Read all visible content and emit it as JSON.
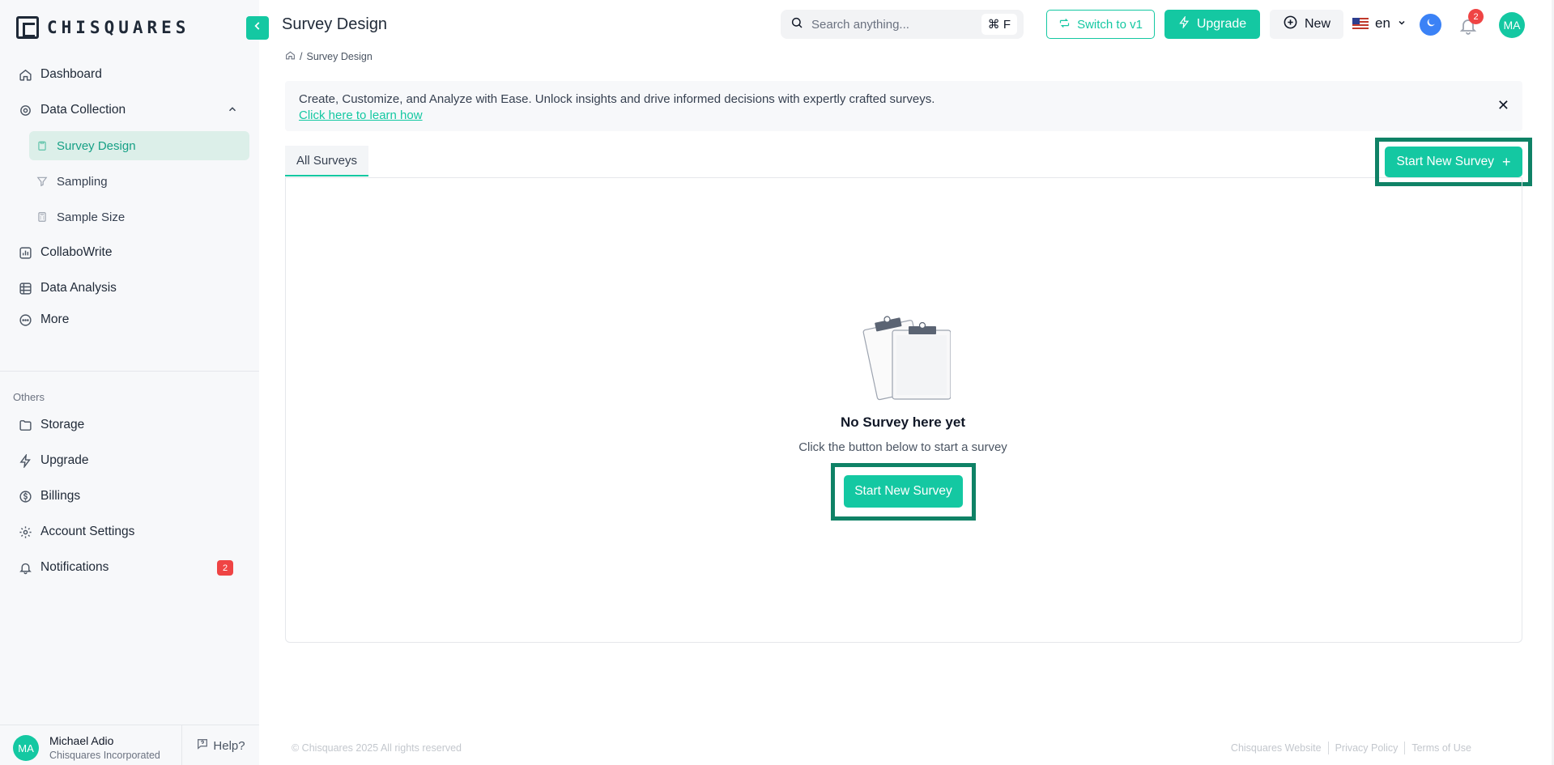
{
  "brand": {
    "name": "CHISQUARES"
  },
  "sidebar": {
    "items": [
      {
        "label": "Dashboard",
        "icon": "home-icon"
      },
      {
        "label": "Data Collection",
        "icon": "data-collection-icon"
      },
      {
        "label": "CollaboWrite",
        "icon": "collabowrite-icon"
      },
      {
        "label": "Data Analysis",
        "icon": "data-analysis-icon"
      },
      {
        "label": "More",
        "icon": "more-icon"
      }
    ],
    "sub_items": [
      {
        "label": "Survey Design",
        "active": true
      },
      {
        "label": "Sampling",
        "active": false
      },
      {
        "label": "Sample Size",
        "active": false
      }
    ],
    "others_label": "Others",
    "other_items": [
      {
        "label": "Storage"
      },
      {
        "label": "Upgrade"
      },
      {
        "label": "Billings"
      },
      {
        "label": "Account Settings"
      },
      {
        "label": "Notifications",
        "badge": "2"
      }
    ],
    "user": {
      "initials": "MA",
      "name": "Michael Adio",
      "org": "Chisquares Incorporated"
    },
    "help_label": "Help?"
  },
  "header": {
    "title": "Survey Design",
    "breadcrumb_current": "Survey Design",
    "search_placeholder": "Search anything...",
    "search_shortcut": "⌘ F",
    "switch_label": "Switch to v1",
    "upgrade_label": "Upgrade",
    "new_label": "New",
    "language": "en",
    "notification_count": "2",
    "avatar_initials": "MA"
  },
  "banner": {
    "text": "Create, Customize, and Analyze with Ease. Unlock insights and drive informed decisions with expertly crafted surveys.",
    "link": "Click here to learn how"
  },
  "tabs": [
    {
      "label": "All Surveys",
      "active": true
    }
  ],
  "actions": {
    "start_new_top": "Start New Survey",
    "start_new_top_icon": "+"
  },
  "empty_state": {
    "title": "No Survey here yet",
    "subtitle": "Click the button below to start a survey",
    "button": "Start New Survey"
  },
  "footer": {
    "copyright": "© Chisquares 2025 All rights reserved",
    "links": [
      "Chisquares Website",
      "Privacy Policy",
      "Terms of Use"
    ]
  },
  "colors": {
    "accent": "#14c8a2",
    "highlight": "#0f8266",
    "danger": "#ef4444",
    "moon": "#3b82f6"
  }
}
